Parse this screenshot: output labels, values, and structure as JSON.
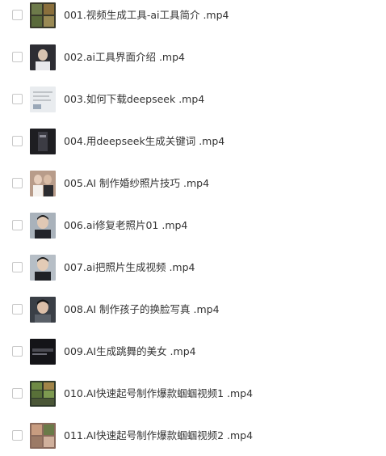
{
  "files": [
    {
      "name": "001.视频生成工具-ai工具简介 .mp4",
      "thumbnail_icon": "video-thumbnail-grid"
    },
    {
      "name": "002.ai工具界面介绍 .mp4",
      "thumbnail_icon": "video-thumbnail-portrait"
    },
    {
      "name": "003.如何下载deepseek .mp4",
      "thumbnail_icon": "video-thumbnail-document"
    },
    {
      "name": "004.用deepseek生成关键词 .mp4",
      "thumbnail_icon": "video-thumbnail-dark"
    },
    {
      "name": "005.AI 制作婚纱照片技巧 .mp4",
      "thumbnail_icon": "video-thumbnail-wedding"
    },
    {
      "name": "006.ai修复老照片01 .mp4",
      "thumbnail_icon": "video-thumbnail-portrait"
    },
    {
      "name": "007.ai把照片生成视频 .mp4",
      "thumbnail_icon": "video-thumbnail-portrait"
    },
    {
      "name": "008.AI 制作孩子的换脸写真 .mp4",
      "thumbnail_icon": "video-thumbnail-portrait"
    },
    {
      "name": "009.AI生成跳舞的美女 .mp4",
      "thumbnail_icon": "video-thumbnail-dark"
    },
    {
      "name": "010.AI快速起号制作爆款蝈蝈视频1 .mp4",
      "thumbnail_icon": "video-thumbnail-grid"
    },
    {
      "name": "011.AI快速起号制作爆款蝈蝈视频2 .mp4",
      "thumbnail_icon": "video-thumbnail-grid"
    }
  ]
}
